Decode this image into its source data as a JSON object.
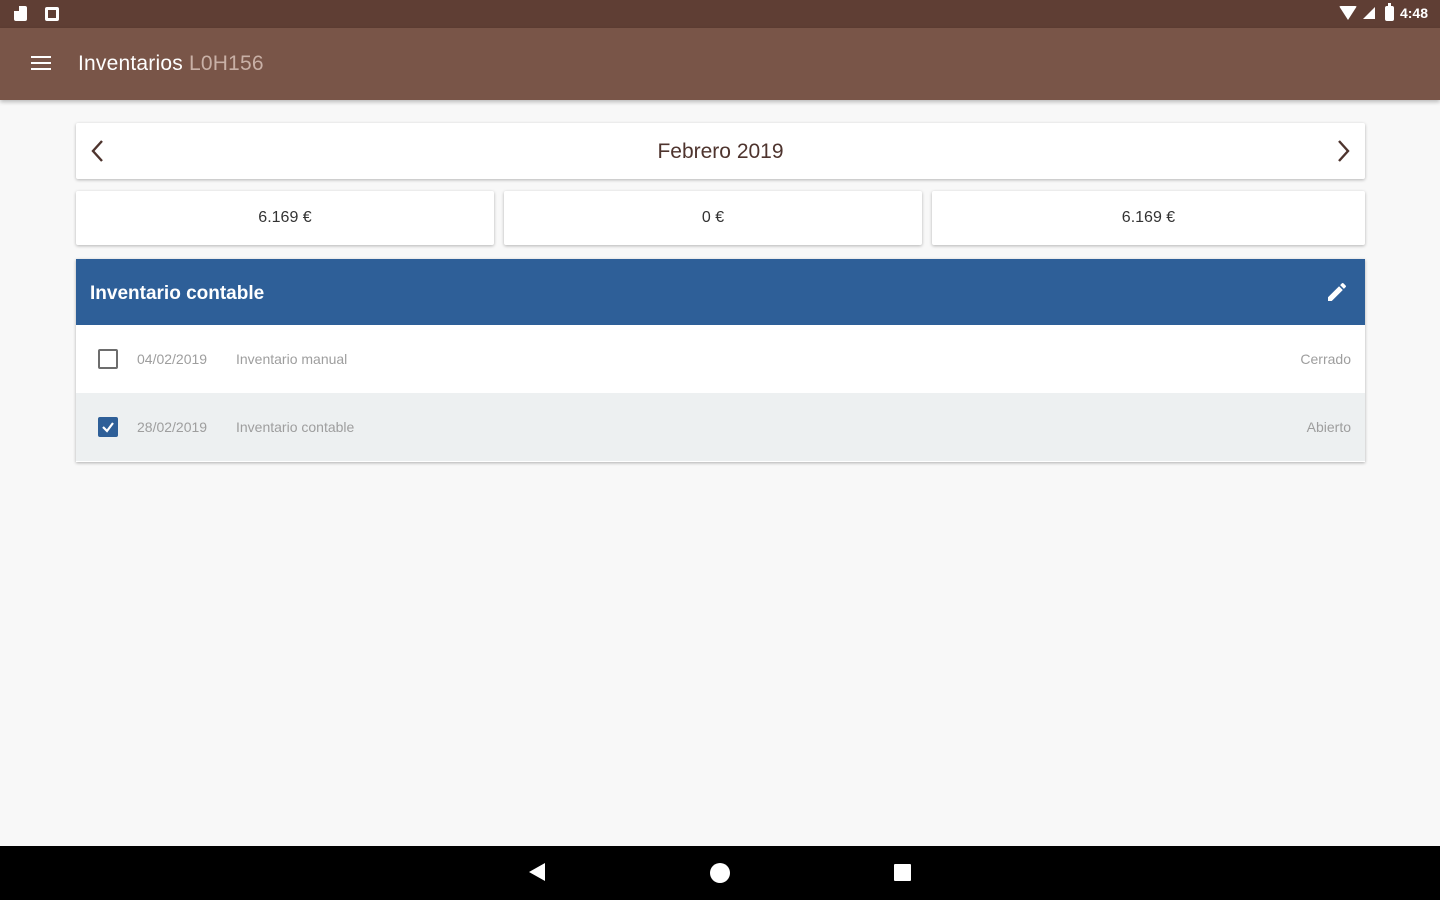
{
  "status_bar": {
    "time": "4:48",
    "icons": [
      "sd-card-icon",
      "square-notification-icon",
      "wifi-icon",
      "signal-icon",
      "battery-icon"
    ]
  },
  "app_bar": {
    "title": "Inventarios",
    "subtitle": "L0H156",
    "menu_icon": "hamburger-menu-icon",
    "background": "#795548"
  },
  "month_selector": {
    "label": "Febrero 2019",
    "prev_icon": "chevron-left-icon",
    "next_icon": "chevron-right-icon"
  },
  "totals": [
    "6.169 €",
    "0 €",
    "6.169 €"
  ],
  "inventory": {
    "title": "Inventario contable",
    "header_color": "#2e5f98",
    "edit_icon": "pencil-icon",
    "rows": [
      {
        "date": "04/02/2019",
        "name": "Inventario manual",
        "status": "Cerrado",
        "checked": false
      },
      {
        "date": "28/02/2019",
        "name": "Inventario contable",
        "status": "Abierto",
        "checked": true
      }
    ]
  },
  "nav_bar": {
    "icons": [
      "back-icon",
      "home-icon",
      "recents-icon"
    ]
  }
}
